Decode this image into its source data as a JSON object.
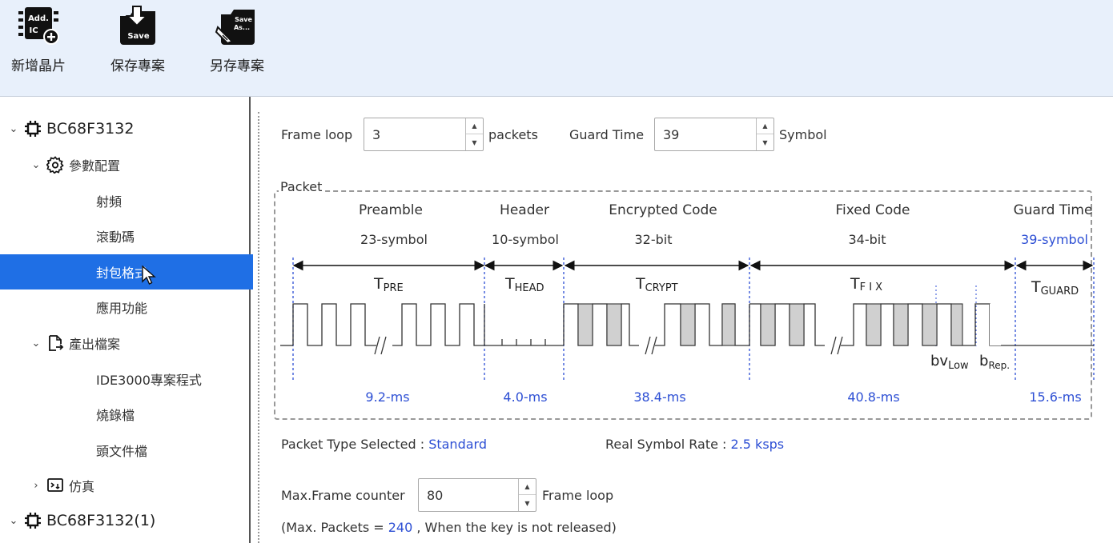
{
  "toolbar": {
    "add_chip": {
      "label": "新增晶片",
      "icon": "add-ic-icon",
      "icon_text_1": "Add.",
      "icon_text_2": "IC"
    },
    "save_project": {
      "label": "保存專案",
      "icon": "save-icon",
      "icon_text": "Save"
    },
    "save_as_project": {
      "label": "另存專案",
      "icon": "save-as-icon",
      "icon_text_1": "Save",
      "icon_text_2": "As..."
    }
  },
  "sidebar": {
    "items": [
      {
        "label": "BC68F3132",
        "level": 0,
        "expanded": true,
        "icon": "chip-icon"
      },
      {
        "label": "參數配置",
        "level": 1,
        "expanded": true,
        "icon": "gear-icon"
      },
      {
        "label": "射頻",
        "level": 2
      },
      {
        "label": "滾動碼",
        "level": 2
      },
      {
        "label": "封包格式",
        "level": 2,
        "selected": true
      },
      {
        "label": "應用功能",
        "level": 2
      },
      {
        "label": "產出檔案",
        "level": 1,
        "expanded": true,
        "icon": "export-file-icon"
      },
      {
        "label": "IDE3000專案程式",
        "level": 2
      },
      {
        "label": "燒錄檔",
        "level": 2
      },
      {
        "label": "頭文件檔",
        "level": 2
      },
      {
        "label": "仿真",
        "level": 1,
        "expanded": false,
        "icon": "emulator-icon"
      },
      {
        "label": "BC68F3132(1)",
        "level": 0,
        "expanded": true,
        "icon": "chip-icon"
      }
    ]
  },
  "frame_loop": {
    "label": "Frame loop",
    "value": "3",
    "unit": "packets"
  },
  "guard_time": {
    "label": "Guard Time",
    "value": "39",
    "unit": "Symbol"
  },
  "packet": {
    "title": "Packet",
    "segments": [
      {
        "name": "Preamble",
        "size": "23-symbol",
        "t_main": "T",
        "t_sub": "PRE",
        "duration": "9.2-ms"
      },
      {
        "name": "Header",
        "size": "10-symbol",
        "t_main": "T",
        "t_sub": "HEAD",
        "duration": "4.0-ms"
      },
      {
        "name": "Encrypted Code",
        "size": "32-bit",
        "t_main": "T",
        "t_sub": "CRYPT",
        "duration": "38.4-ms"
      },
      {
        "name": "Fixed Code",
        "size": "34-bit",
        "t_main": "T",
        "t_sub": "F I X",
        "duration": "40.8-ms"
      },
      {
        "name": "Guard Time",
        "size": "39-symbol",
        "t_main": "T",
        "t_sub": "GUARD",
        "duration": "15.6-ms"
      }
    ],
    "bv_low": {
      "main": "bv",
      "sub": "Low"
    },
    "b_rep": {
      "main": "b",
      "sub": "Rep."
    }
  },
  "packet_type": {
    "label": "Packet Type Selected : ",
    "value": "Standard"
  },
  "symbol_rate": {
    "label": "Real Symbol Rate : ",
    "value": "2.5 ksps"
  },
  "max_frame": {
    "label": "Max.Frame counter",
    "value": "80",
    "unit": "Frame loop"
  },
  "max_packets": {
    "prefix": "(Max. Packets = ",
    "value": "240",
    "suffix": " , When the key is not released)"
  },
  "colors": {
    "accent_blue": "#2d4fd4",
    "selection": "#1f6fe5",
    "toolbar_bg": "#e8f0fb",
    "bit_fill": "#d0d0d0"
  }
}
